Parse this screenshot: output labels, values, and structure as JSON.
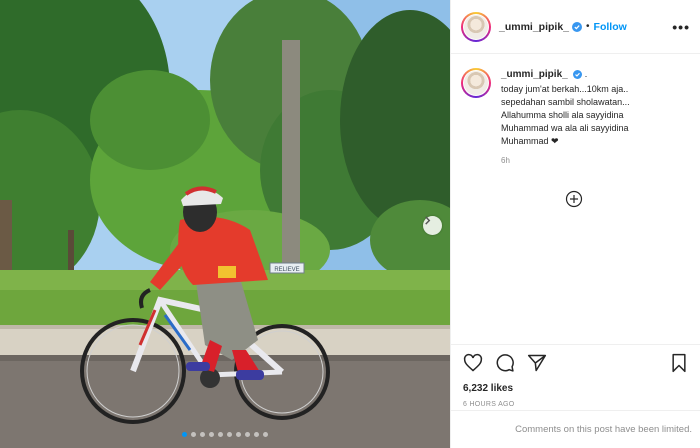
{
  "post": {
    "username": "_ummi_pipik_",
    "header_separator": "•",
    "follow_label": "Follow",
    "more_label": "•••",
    "caption_separator": ".",
    "caption": "today jum'at berkah...10km aja..\nsepedahan sambil sholawatan...\nAllahumma sholli ala sayyidina\nMuhammad wa ala ali sayyidina\nMuhammad ❤",
    "relative_time": "6h",
    "likes": "6,232 likes",
    "posted_ago": "6 HOURS AGO",
    "comments_notice": "Comments on this post have been limited."
  },
  "carousel": {
    "total_slides": 10,
    "active_index": 0,
    "sign_text": "RELIEVE"
  },
  "colors": {
    "accent": "#0095f6",
    "text": "#262626",
    "muted": "#8e8e8e"
  },
  "icons": [
    "verified-badge-icon",
    "more-options-icon",
    "add-comment-icon",
    "heart-icon",
    "comment-icon",
    "share-icon",
    "bookmark-icon",
    "next-arrow-icon"
  ]
}
